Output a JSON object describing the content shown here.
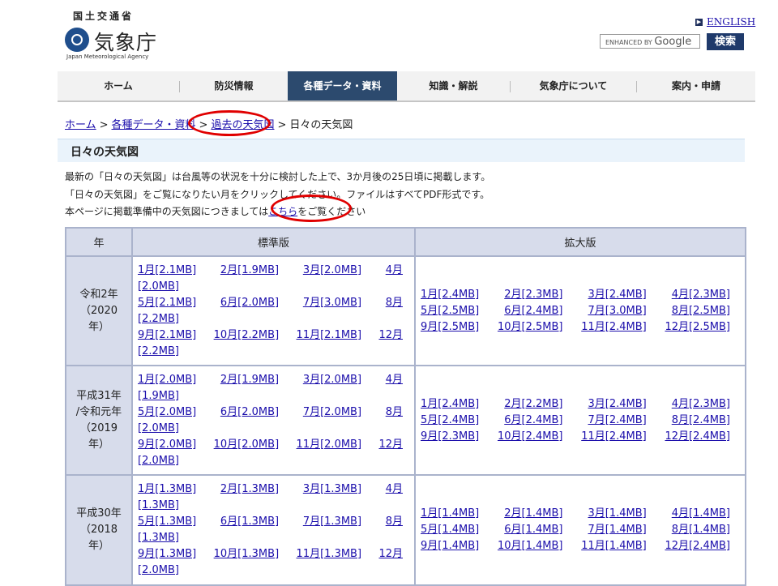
{
  "header": {
    "ministry": "国土交通省",
    "agency_name": "気象庁",
    "agency_en": "Japan Meteorological Agency",
    "english_link": "ENGLISH",
    "search_placeholder_prefix": "ENHANCED BY",
    "search_placeholder_brand": "Google",
    "search_button": "検索"
  },
  "nav": {
    "items": [
      {
        "label": "ホーム"
      },
      {
        "label": "防災情報"
      },
      {
        "label": "各種データ・資料"
      },
      {
        "label": "知識・解説"
      },
      {
        "label": "気象庁について"
      },
      {
        "label": "案内・申請"
      }
    ],
    "active_index": 2
  },
  "breadcrumb": {
    "items": [
      "ホーム",
      "各種データ・資料",
      "過去の天気図"
    ],
    "current": "日々の天気図",
    "separator": ">"
  },
  "page_title": "日々の天気図",
  "intro": {
    "line1": "最新の「日々の天気図」は台風等の状況を十分に検討した上で、3か月後の25日頃に掲載します。",
    "line2": "「日々の天気図」をご覧になりたい月をクリックしてください。ファイルはすべてPDF形式です。",
    "line3_pre": "本ページに掲載準備中の天気図につきましては",
    "line3_link": "こちら",
    "line3_post": "をご覧ください"
  },
  "annotation_color": "#e00000",
  "table": {
    "headers": {
      "year": "年",
      "standard": "標準版",
      "large": "拡大版"
    },
    "rows": [
      {
        "year_lines": [
          "令和2年",
          "（2020",
          "年）"
        ],
        "standard": [
          [
            "1月[2.1MB]",
            "2月[1.9MB]",
            "3月[2.0MB]",
            "4月",
            "[2.0MB]"
          ],
          [
            "5月[2.1MB]",
            "6月[2.0MB]",
            "7月[3.0MB]",
            "8月",
            "[2.2MB]"
          ],
          [
            "9月[2.1MB]",
            "10月[2.2MB]",
            "11月[2.1MB]",
            "12月",
            "[2.2MB]"
          ]
        ],
        "large": [
          [
            "1月[2.4MB]",
            "2月[2.3MB]",
            "3月[2.4MB]",
            "4月[2.3MB]"
          ],
          [
            "5月[2.5MB]",
            "6月[2.4MB]",
            "7月[3.0MB]",
            "8月[2.5MB]"
          ],
          [
            "9月[2.5MB]",
            "10月[2.5MB]",
            "11月[2.4MB]",
            "12月[2.5MB]"
          ]
        ]
      },
      {
        "year_lines": [
          "平成31年",
          "/令和元年",
          "（2019",
          "年）"
        ],
        "standard": [
          [
            "1月[2.0MB]",
            "2月[1.9MB]",
            "3月[2.0MB]",
            "4月",
            "[1.9MB]"
          ],
          [
            "5月[2.0MB]",
            "6月[2.0MB]",
            "7月[2.0MB]",
            "8月",
            "[2.0MB]"
          ],
          [
            "9月[2.0MB]",
            "10月[2.0MB]",
            "11月[2.0MB]",
            "12月",
            "[2.0MB]"
          ]
        ],
        "large": [
          [
            "1月[2.4MB]",
            "2月[2.2MB]",
            "3月[2.4MB]",
            "4月[2.3MB]"
          ],
          [
            "5月[2.4MB]",
            "6月[2.4MB]",
            "7月[2.4MB]",
            "8月[2.4MB]"
          ],
          [
            "9月[2.3MB]",
            "10月[2.4MB]",
            "11月[2.4MB]",
            "12月[2.4MB]"
          ]
        ]
      },
      {
        "year_lines": [
          "平成30年",
          "（2018",
          "年）"
        ],
        "standard": [
          [
            "1月[1.3MB]",
            "2月[1.3MB]",
            "3月[1.3MB]",
            "4月",
            "[1.3MB]"
          ],
          [
            "5月[1.3MB]",
            "6月[1.3MB]",
            "7月[1.3MB]",
            "8月",
            "[1.3MB]"
          ],
          [
            "9月[1.3MB]",
            "10月[1.3MB]",
            "11月[1.3MB]",
            "12月",
            "[2.0MB]"
          ]
        ],
        "large": [
          [
            "1月[1.4MB]",
            "2月[1.4MB]",
            "3月[1.4MB]",
            "4月[1.4MB]"
          ],
          [
            "5月[1.4MB]",
            "6月[1.4MB]",
            "7月[1.4MB]",
            "8月[1.4MB]"
          ],
          [
            "9月[1.4MB]",
            "10月[1.4MB]",
            "11月[1.4MB]",
            "12月[2.4MB]"
          ]
        ]
      }
    ]
  }
}
